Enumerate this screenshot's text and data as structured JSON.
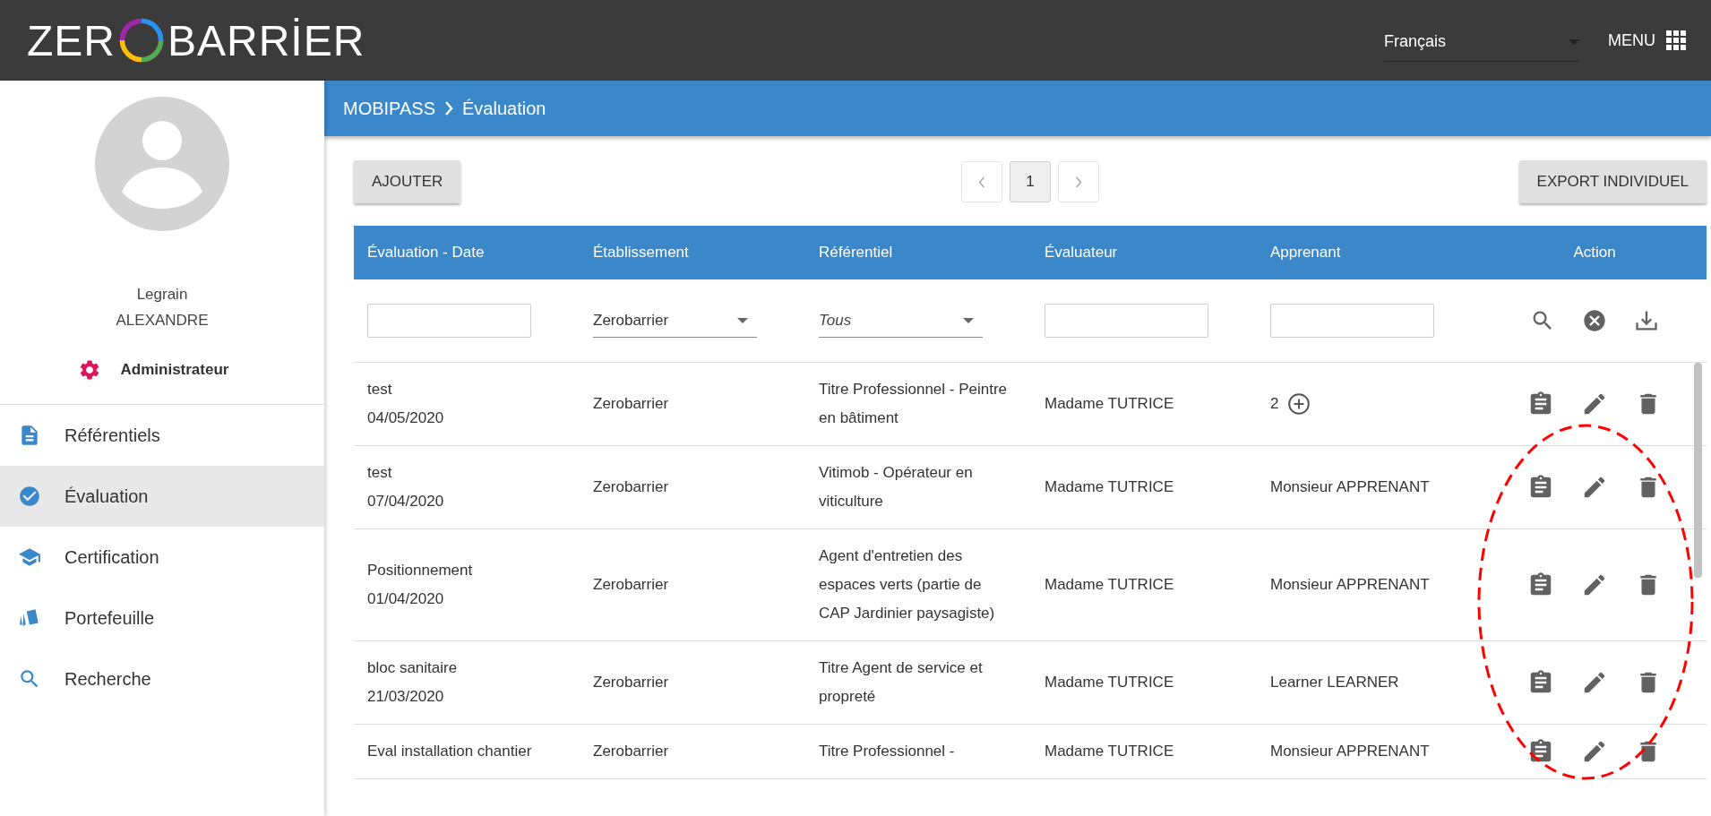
{
  "header": {
    "logo": {
      "before": "ZER",
      "after": "BARRİER"
    },
    "language": {
      "value": "Français"
    },
    "menu": {
      "label": "MENU"
    }
  },
  "sidebar": {
    "user": {
      "first_name": "Legrain",
      "last_name": "ALEXANDRE",
      "role": "Administrateur"
    },
    "items": [
      {
        "label": "Référentiels",
        "selected": false
      },
      {
        "label": "Évaluation",
        "selected": true
      },
      {
        "label": "Certification",
        "selected": false
      },
      {
        "label": "Portefeuille",
        "selected": false
      },
      {
        "label": "Recherche",
        "selected": false
      }
    ]
  },
  "breadcrumb": [
    "MOBIPASS",
    "Évaluation"
  ],
  "toolbar": {
    "add_button": "AJOUTER",
    "pagination": [
      {
        "label": "1",
        "selected": true
      }
    ],
    "export_button": "EXPORT INDIVIDUEL"
  },
  "table": {
    "columns": [
      "Évaluation - Date",
      "Établissement",
      "Référentiel",
      "Évaluateur",
      "Apprenant",
      "Action"
    ],
    "filters": [
      {
        "kind": "text"
      },
      {
        "kind": "select",
        "value": "Zerobarrier"
      },
      {
        "kind": "select",
        "placeholder": "Tous"
      },
      {
        "kind": "text"
      },
      {
        "kind": "text"
      },
      {
        "kind": "actions"
      }
    ],
    "rows": [
      {
        "title": "test",
        "date": "04/05/2020",
        "establishment": "Zerobarrier",
        "referential": "Titre Professionnel - Peintre en bâtiment",
        "evaluator": "Madame TUTRICE",
        "learner": {
          "kind": "count",
          "text": "2"
        }
      },
      {
        "title": "test",
        "date": "07/04/2020",
        "establishment": "Zerobarrier",
        "referential": "Vitimob - Opérateur en viticulture",
        "evaluator": "Madame TUTRICE",
        "learner": {
          "kind": "name",
          "text": "Monsieur APPRENANT"
        }
      },
      {
        "title": "Positionnement",
        "date": "01/04/2020",
        "establishment": "Zerobarrier",
        "referential": "Agent d'entretien des espaces verts (partie de CAP Jardinier paysagiste)",
        "evaluator": "Madame TUTRICE",
        "learner": {
          "kind": "name",
          "text": "Monsieur APPRENANT"
        }
      },
      {
        "title": "bloc sanitaire",
        "date": "21/03/2020",
        "establishment": "Zerobarrier",
        "referential": "Titre Agent de service et propreté",
        "evaluator": "Madame TUTRICE",
        "learner": {
          "kind": "name",
          "text": "Learner LEARNER"
        }
      },
      {
        "title": "Eval installation chantier",
        "establishment": "Zerobarrier",
        "referential": "Titre Professionnel -",
        "evaluator": "Madame TUTRICE",
        "learner": {
          "kind": "name",
          "text": "Monsieur APPRENANT"
        }
      }
    ]
  },
  "annotation": {
    "kind": "dashed-ellipse"
  }
}
